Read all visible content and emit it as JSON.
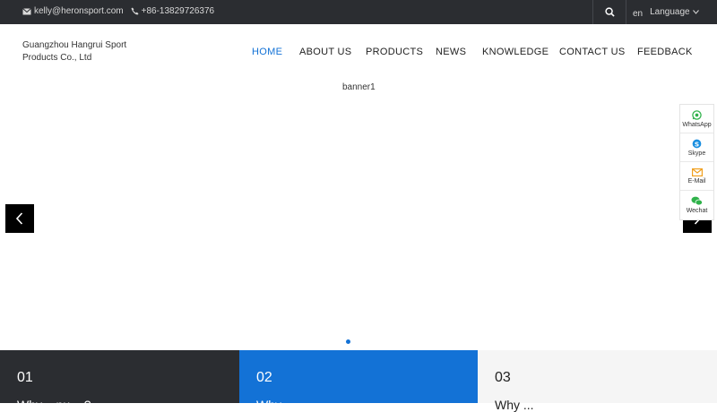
{
  "topbar": {
    "email": "kelly@heronsport.com",
    "phone": "+86-13829726376",
    "lang_code": "en",
    "lang_label": "Language"
  },
  "header": {
    "logo_text": "Guangzhou Hangrui Sport Products Co., Ltd",
    "nav": [
      "HOME",
      "ABOUT US",
      "PRODUCTS",
      "NEWS",
      "KNOWLEDGE",
      "CONTACT US",
      "FEEDBACK"
    ],
    "active": "HOME"
  },
  "banner": {
    "alt_text": "banner1"
  },
  "float_bar": {
    "items": [
      "WhatsApp",
      "Skype",
      "E-Mail",
      "Wechat"
    ]
  },
  "features": [
    {
      "num": "01",
      "title": "Why ...nu... ?"
    },
    {
      "num": "02",
      "title": "Why ..."
    },
    {
      "num": "03",
      "title": "Why ..."
    }
  ],
  "colors": {
    "accent": "#1372d6",
    "topbar": "#2b2d31"
  }
}
